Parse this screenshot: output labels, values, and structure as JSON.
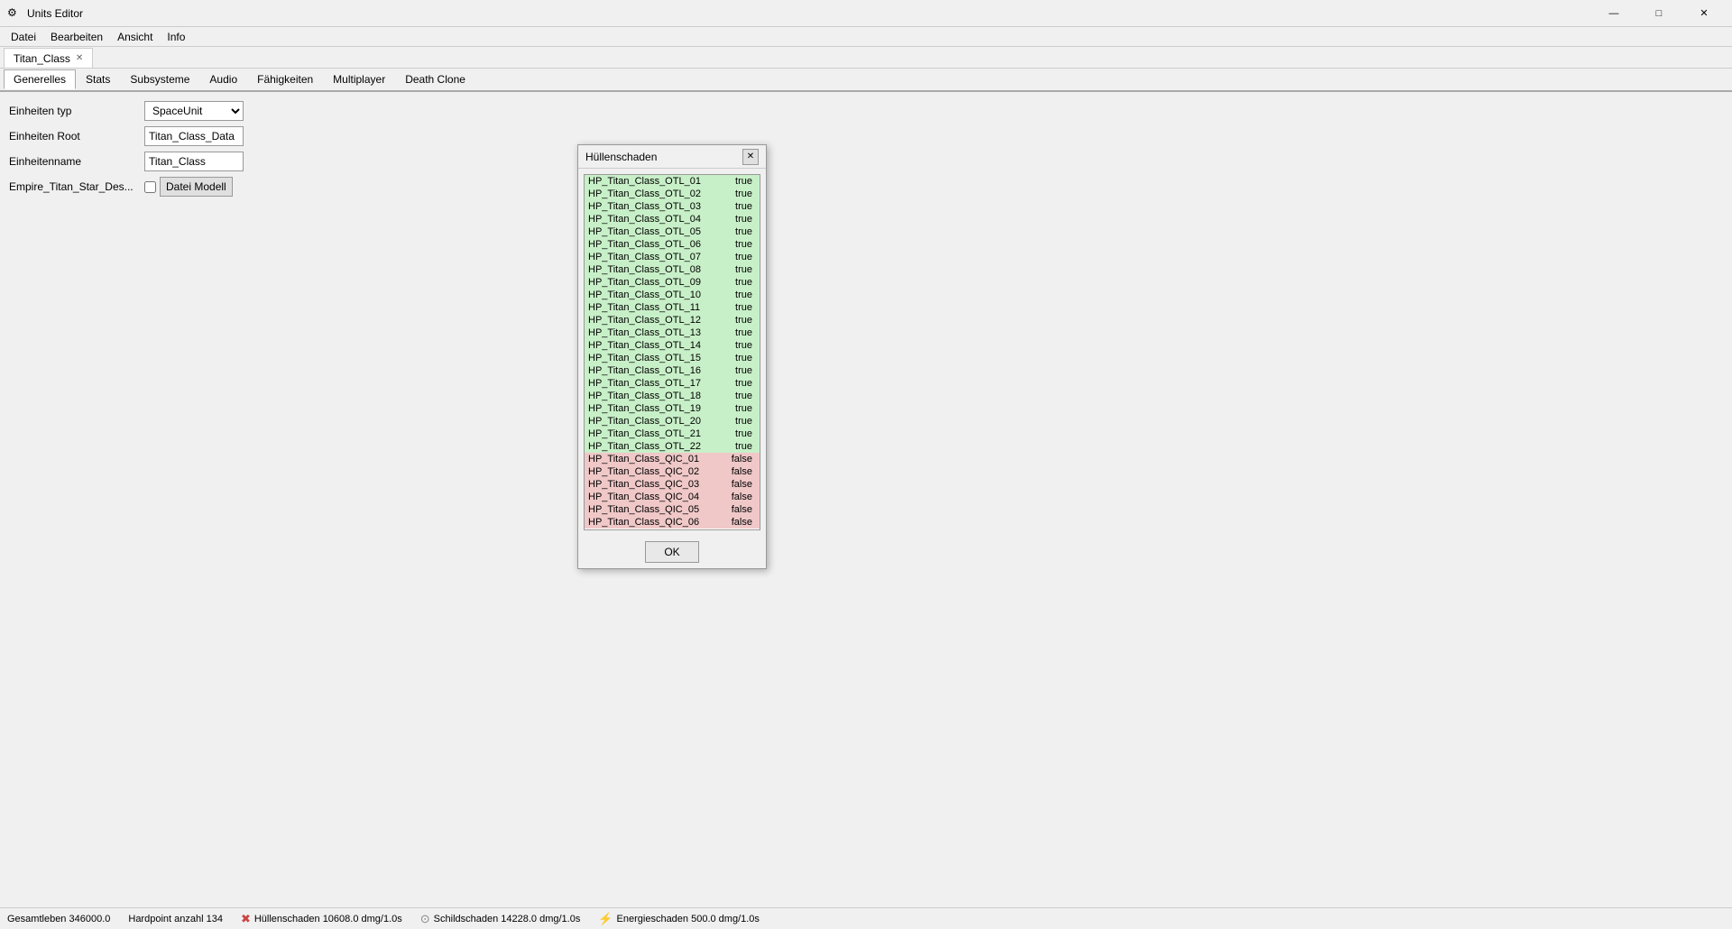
{
  "titleBar": {
    "icon": "⚙",
    "title": "Units Editor",
    "minimizeLabel": "—",
    "maximizeLabel": "□",
    "closeLabel": "✕"
  },
  "menuBar": {
    "items": [
      "Datei",
      "Bearbeiten",
      "Ansicht",
      "Info"
    ]
  },
  "docTabs": [
    {
      "label": "Titan_Class",
      "active": true,
      "closable": true
    }
  ],
  "featureTabs": [
    {
      "label": "Generelles",
      "active": true
    },
    {
      "label": "Stats"
    },
    {
      "label": "Subsysteme"
    },
    {
      "label": "Audio"
    },
    {
      "label": "Fähigkeiten"
    },
    {
      "label": "Multiplayer"
    },
    {
      "label": "Death Clone"
    }
  ],
  "form": {
    "einheitenTypLabel": "Einheiten typ",
    "einheitenTypValue": "SpaceUnit",
    "einheitenRootLabel": "Einheiten Root",
    "einheitenRootValue": "Titan_Class_Data",
    "einheitennameLabel": "Einheitenname",
    "einheitennameValue": "Titan_Class",
    "empireTitanLabel": "Empire_Titan_Star_Des...",
    "dateiModellLabel": "Datei Modell"
  },
  "dialog": {
    "title": "Hüllenschaden",
    "closeLabel": "✕",
    "okLabel": "OK",
    "items": [
      {
        "name": "HP_Titan_Class_OTL_01",
        "value": "true",
        "type": "green"
      },
      {
        "name": "HP_Titan_Class_OTL_02",
        "value": "true",
        "type": "green"
      },
      {
        "name": "HP_Titan_Class_OTL_03",
        "value": "true",
        "type": "green"
      },
      {
        "name": "HP_Titan_Class_OTL_04",
        "value": "true",
        "type": "green"
      },
      {
        "name": "HP_Titan_Class_OTL_05",
        "value": "true",
        "type": "green"
      },
      {
        "name": "HP_Titan_Class_OTL_06",
        "value": "true",
        "type": "green"
      },
      {
        "name": "HP_Titan_Class_OTL_07",
        "value": "true",
        "type": "green"
      },
      {
        "name": "HP_Titan_Class_OTL_08",
        "value": "true",
        "type": "green"
      },
      {
        "name": "HP_Titan_Class_OTL_09",
        "value": "true",
        "type": "green"
      },
      {
        "name": "HP_Titan_Class_OTL_10",
        "value": "true",
        "type": "green"
      },
      {
        "name": "HP_Titan_Class_OTL_11",
        "value": "true",
        "type": "green"
      },
      {
        "name": "HP_Titan_Class_OTL_12",
        "value": "true",
        "type": "green"
      },
      {
        "name": "HP_Titan_Class_OTL_13",
        "value": "true",
        "type": "green"
      },
      {
        "name": "HP_Titan_Class_OTL_14",
        "value": "true",
        "type": "green"
      },
      {
        "name": "HP_Titan_Class_OTL_15",
        "value": "true",
        "type": "green"
      },
      {
        "name": "HP_Titan_Class_OTL_16",
        "value": "true",
        "type": "green"
      },
      {
        "name": "HP_Titan_Class_OTL_17",
        "value": "true",
        "type": "green"
      },
      {
        "name": "HP_Titan_Class_OTL_18",
        "value": "true",
        "type": "green"
      },
      {
        "name": "HP_Titan_Class_OTL_19",
        "value": "true",
        "type": "green"
      },
      {
        "name": "HP_Titan_Class_OTL_20",
        "value": "true",
        "type": "green"
      },
      {
        "name": "HP_Titan_Class_OTL_21",
        "value": "true",
        "type": "green"
      },
      {
        "name": "HP_Titan_Class_OTL_22",
        "value": "true",
        "type": "green"
      },
      {
        "name": "HP_Titan_Class_QIC_01",
        "value": "false",
        "type": "red"
      },
      {
        "name": "HP_Titan_Class_QIC_02",
        "value": "false",
        "type": "red"
      },
      {
        "name": "HP_Titan_Class_QIC_03",
        "value": "false",
        "type": "red"
      },
      {
        "name": "HP_Titan_Class_QIC_04",
        "value": "false",
        "type": "red"
      },
      {
        "name": "HP_Titan_Class_QIC_05",
        "value": "false",
        "type": "red"
      },
      {
        "name": "HP_Titan_Class_QIC_06",
        "value": "false",
        "type": "red"
      }
    ]
  },
  "statusBar": {
    "gesamtleben": "Gesamtleben 346000.0",
    "hardpoint": "Hardpoint anzahl 134",
    "hullenschadenIcon": "✖",
    "hullenschaden": "Hüllenschaden  10608.0 dmg/1.0s",
    "schildschadenIcon": "⊙",
    "schildschaden": "Schildschaden  14228.0 dmg/1.0s",
    "energieschadenIcon": "⚡",
    "energieschaden": "Energieschaden  500.0 dmg/1.0s"
  }
}
